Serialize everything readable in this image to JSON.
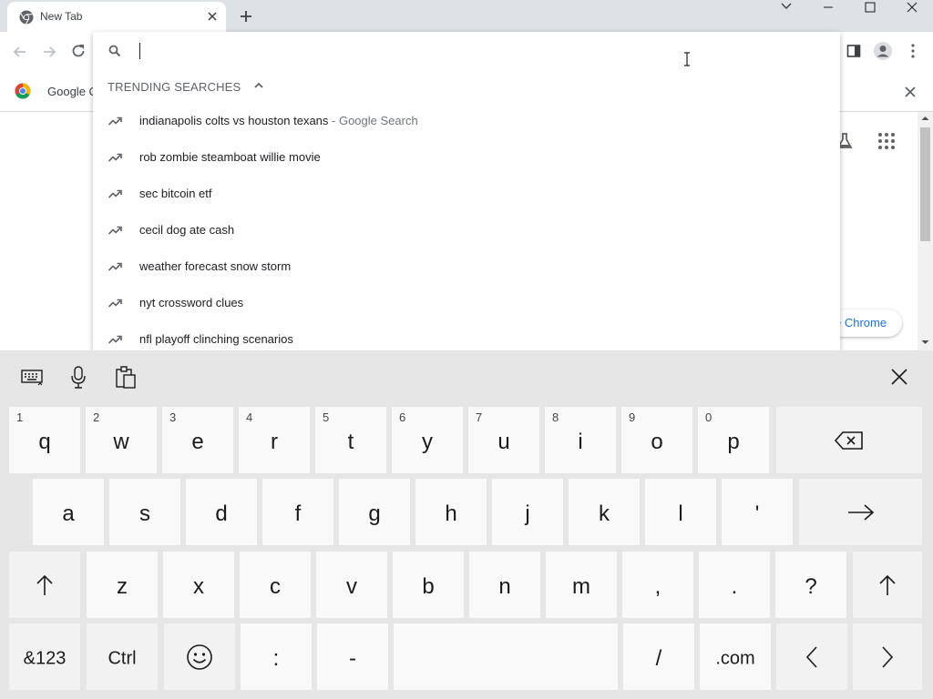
{
  "browser": {
    "tab_title": "New Tab",
    "bookmark_partial": "Google C",
    "chrome_pill_text": "e Chrome"
  },
  "omnibox": {
    "trending_header": "TRENDING SEARCHES",
    "suggestions": [
      {
        "text": "indianapolis colts vs houston texans",
        "sub": " - Google Search"
      },
      {
        "text": "rob zombie steamboat willie movie",
        "sub": ""
      },
      {
        "text": "sec bitcoin etf",
        "sub": ""
      },
      {
        "text": "cecil dog ate cash",
        "sub": ""
      },
      {
        "text": "weather forecast snow storm",
        "sub": ""
      },
      {
        "text": "nyt crossword clues",
        "sub": ""
      },
      {
        "text": "nfl playoff clinching scenarios",
        "sub": ""
      }
    ]
  },
  "keyboard": {
    "row1": [
      {
        "label": "q",
        "num": "1"
      },
      {
        "label": "w",
        "num": "2"
      },
      {
        "label": "e",
        "num": "3"
      },
      {
        "label": "r",
        "num": "4"
      },
      {
        "label": "t",
        "num": "5"
      },
      {
        "label": "y",
        "num": "6"
      },
      {
        "label": "u",
        "num": "7"
      },
      {
        "label": "i",
        "num": "8"
      },
      {
        "label": "o",
        "num": "9"
      },
      {
        "label": "p",
        "num": "0"
      }
    ],
    "row2": [
      "a",
      "s",
      "d",
      "f",
      "g",
      "h",
      "j",
      "k",
      "l",
      "'"
    ],
    "row3": [
      "z",
      "x",
      "c",
      "v",
      "b",
      "n",
      "m",
      ",",
      ".",
      "?"
    ],
    "row4": {
      "symbols": "&123",
      "ctrl": "Ctrl",
      "colon": ":",
      "dash": "-",
      "slash": "/",
      "dotcom": ".com"
    }
  },
  "colors": {
    "accent": "#1a73e8",
    "keyboard_bg": "#e6e6e6",
    "key_bg": "#f9f9f9"
  }
}
